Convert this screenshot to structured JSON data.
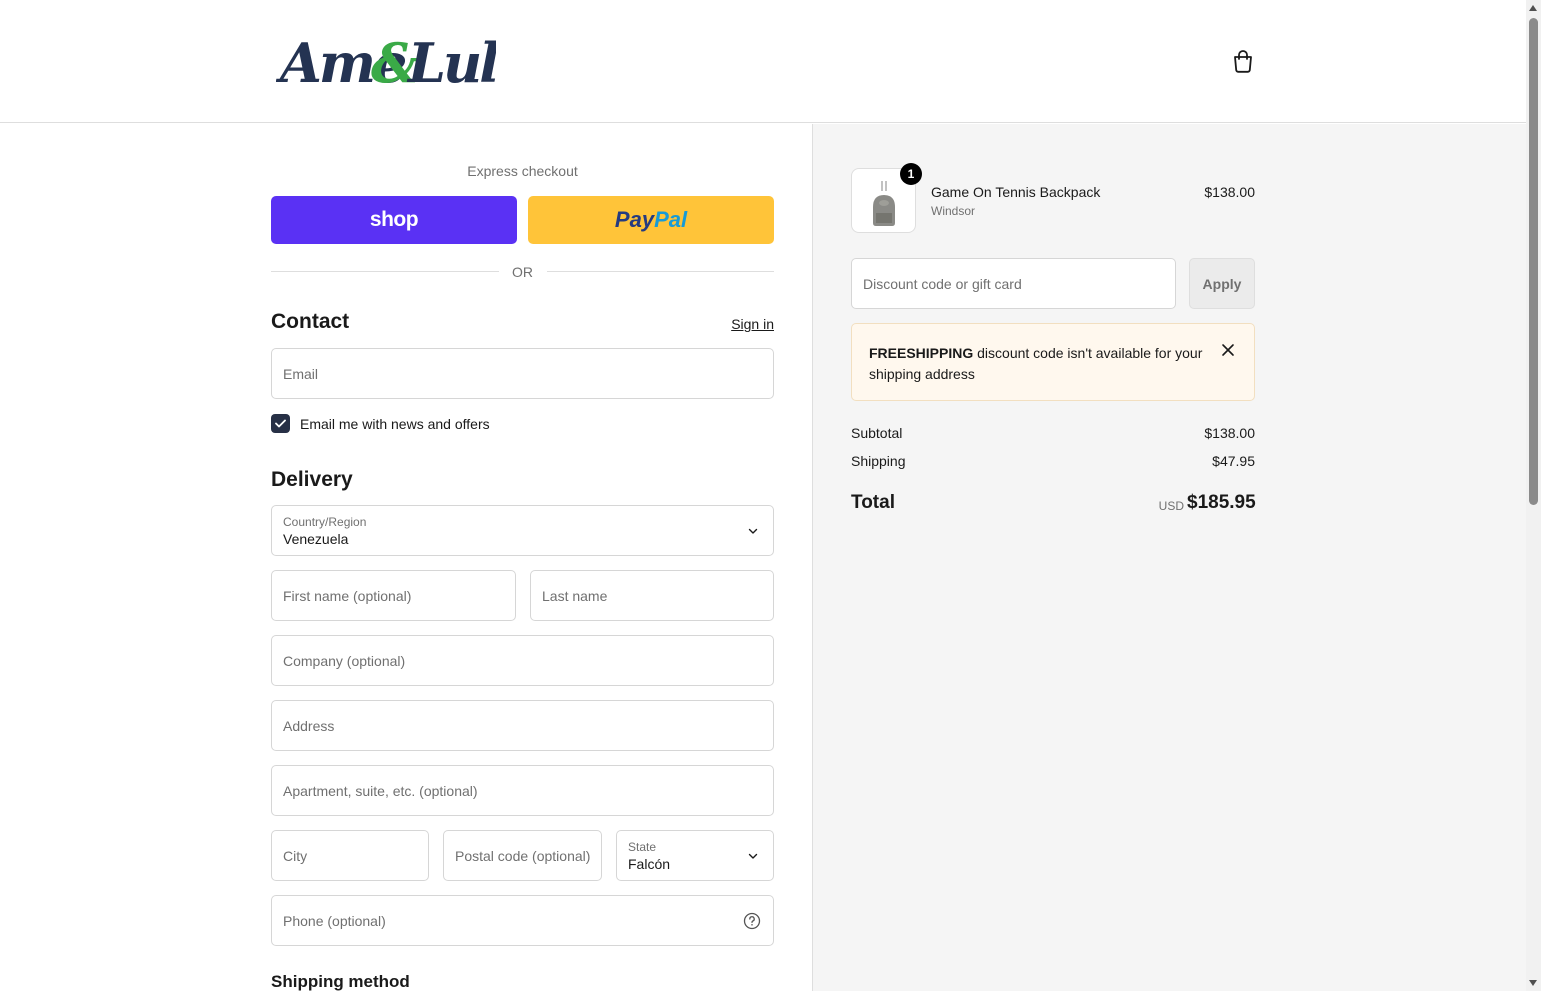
{
  "brand": {
    "logo_text": "Ame&Lulu"
  },
  "express": {
    "label": "Express checkout",
    "shop_label": "shop",
    "paypal_pay": "Pay",
    "paypal_pal": "Pal",
    "or_label": "OR"
  },
  "contact": {
    "heading": "Contact",
    "sign_in": "Sign in",
    "email_placeholder": "Email",
    "newsletter_label": "Email me with news and offers",
    "newsletter_checked": true
  },
  "delivery": {
    "heading": "Delivery",
    "country_label": "Country/Region",
    "country_value": "Venezuela",
    "first_name_placeholder": "First name (optional)",
    "last_name_placeholder": "Last name",
    "company_placeholder": "Company (optional)",
    "address_placeholder": "Address",
    "apartment_placeholder": "Apartment, suite, etc. (optional)",
    "city_placeholder": "City",
    "postal_placeholder": "Postal code (optional)",
    "state_label": "State",
    "state_value": "Falcón",
    "phone_placeholder": "Phone (optional)"
  },
  "shipping_method": {
    "heading": "Shipping method"
  },
  "summary": {
    "product": {
      "name": "Game On Tennis Backpack",
      "variant": "Windsor",
      "price": "$138.00",
      "quantity": "1"
    },
    "discount_placeholder": "Discount code or gift card",
    "apply_label": "Apply",
    "notice": {
      "code": "FREESHIPPING",
      "message": " discount code isn't available for your shipping address"
    },
    "subtotal_label": "Subtotal",
    "subtotal_value": "$138.00",
    "shipping_label": "Shipping",
    "shipping_value": "$47.95",
    "total_label": "Total",
    "total_currency": "USD",
    "total_value": "$185.95"
  },
  "colors": {
    "shop_pay": "#5a31f4",
    "paypal": "#ffc439",
    "checkbox": "#273046",
    "sidebar_bg": "#f5f5f5"
  }
}
